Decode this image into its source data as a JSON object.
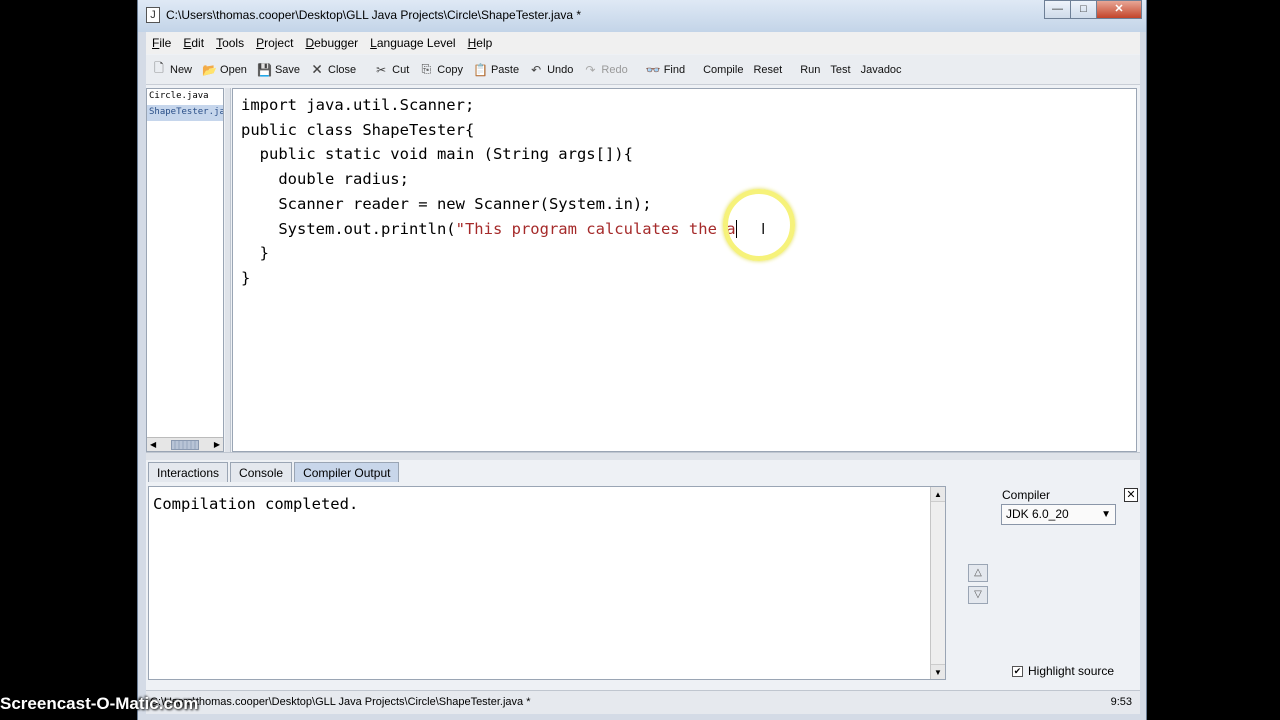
{
  "window": {
    "title": "C:\\Users\\thomas.cooper\\Desktop\\GLL Java Projects\\Circle\\ShapeTester.java *",
    "app_icon": "J",
    "controls": [
      "—",
      "□",
      "✕"
    ]
  },
  "menu": [
    "File",
    "Edit",
    "Tools",
    "Project",
    "Debugger",
    "Language Level",
    "Help"
  ],
  "toolbar": {
    "new": "New",
    "open": "Open",
    "save": "Save",
    "close": "Close",
    "cut": "Cut",
    "copy": "Copy",
    "paste": "Paste",
    "undo": "Undo",
    "redo": "Redo",
    "find": "Find",
    "compile": "Compile",
    "reset": "Reset",
    "run": "Run",
    "test": "Test",
    "javadoc": "Javadoc"
  },
  "files": [
    "Circle.java",
    "ShapeTester.java *"
  ],
  "code": {
    "line1": "import java.util.Scanner;",
    "line2": "public class ShapeTester{",
    "line3": "  public static void main (String args[]){",
    "line4": "",
    "line5": "    double radius;",
    "line6": "",
    "line7": "    Scanner reader = new Scanner(System.in);",
    "line8": "",
    "line9a": "    System.out.println(",
    "line9b": "\"This program calculates the a",
    "line10": "",
    "line11": "  }",
    "line12": "}"
  },
  "tabs": [
    "Interactions",
    "Console",
    "Compiler Output"
  ],
  "output_text": "Compilation completed.",
  "compiler": {
    "label": "Compiler",
    "selected": "JDK 6.0_20",
    "highlight_label": "Highlight source",
    "highlight_checked": true
  },
  "status": {
    "path": "C:\\Users\\thomas.cooper\\Desktop\\GLL Java Projects\\Circle\\ShapeTester.java *",
    "position": "9:53"
  },
  "watermark": "Screencast-O-Matic.com"
}
